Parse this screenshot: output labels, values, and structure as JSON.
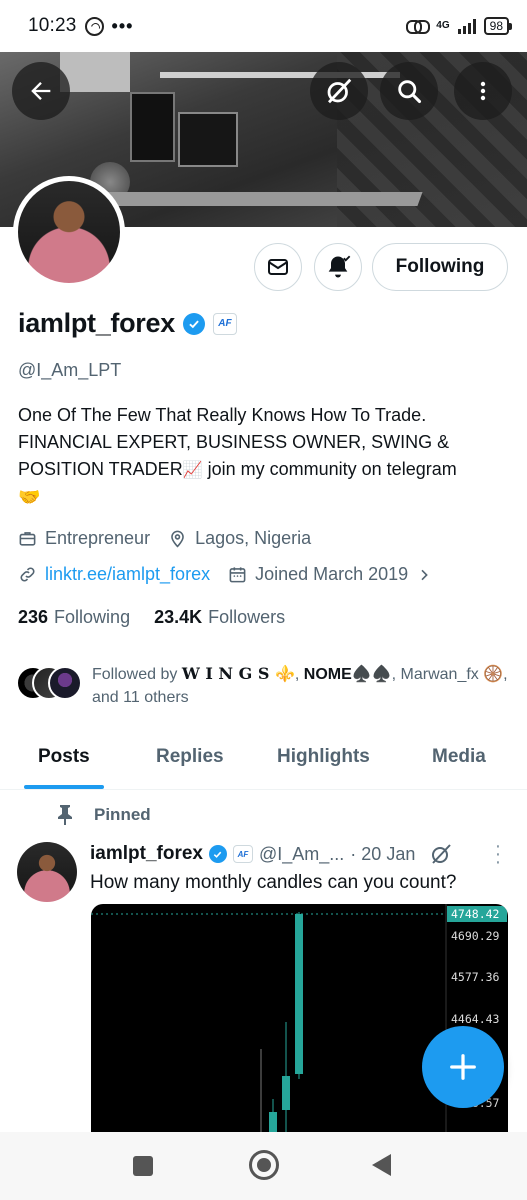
{
  "status_bar": {
    "time": "10:23",
    "dots": "•••",
    "network": "4G",
    "battery": "98"
  },
  "profile": {
    "name": "iamlpt_forex",
    "affiliate_badge": "AF",
    "handle": "@I_Am_LPT",
    "bio_line1": "One Of The Few That Really Knows How To Trade.",
    "bio_line2": "FINANCIAL EXPERT, BUSINESS OWNER, SWING &",
    "bio_line3a": "POSITION TRADER",
    "bio_line3b": " join my community on telegram",
    "bio_emoji_chart": "📈",
    "bio_emoji_hands": "🤝",
    "profession": "Entrepreneur",
    "location": "Lagos, Nigeria",
    "link": "linktr.ee/iamlpt_forex",
    "joined": "Joined March 2019",
    "following_count": "236",
    "following_label": "Following",
    "followers_count": "23.4K",
    "followers_label": "Followers",
    "follow_button": "Following"
  },
  "followed_by": {
    "prefix": "Followed by ",
    "user1": "𝐖 𝐈 𝐍 𝐆 𝐒 ⚜️",
    "sep1": ", ",
    "user2": "NOME♠️♠️",
    "sep2": ", ",
    "user3": "Marwan_fx 🛞",
    "suffix": ", and 11 others"
  },
  "tabs": [
    "Posts",
    "Replies",
    "Highlights",
    "Media"
  ],
  "pinned_label": "Pinned",
  "post": {
    "name": "iamlpt_forex",
    "badge": "AF",
    "handle": "@I_Am_...",
    "date": "· 20 Jan",
    "text": "How many monthly candles can you count?",
    "chart_prices": [
      "4748.42",
      "4690.29",
      "4577.36",
      "4464.43",
      "4238.57"
    ]
  },
  "colors": {
    "accent": "#1d9bf0",
    "text_primary": "#0f1419",
    "text_secondary": "#536471",
    "candle_green": "#26a69a"
  }
}
